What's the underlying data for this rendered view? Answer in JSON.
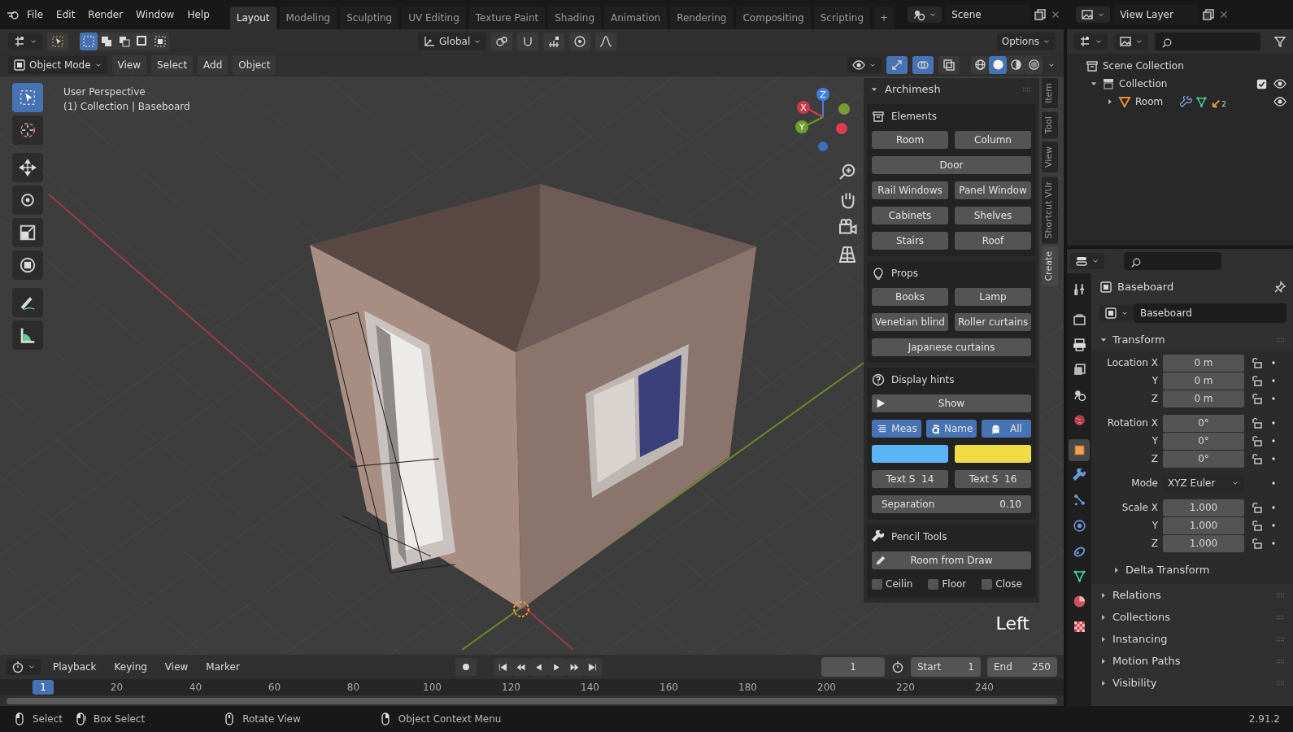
{
  "menu": [
    "File",
    "Edit",
    "Render",
    "Window",
    "Help"
  ],
  "workspaces": [
    {
      "label": "Layout",
      "selected": true
    },
    {
      "label": "Modeling",
      "selected": false
    },
    {
      "label": "Sculpting",
      "selected": false
    },
    {
      "label": "UV Editing",
      "selected": false
    },
    {
      "label": "Texture Paint",
      "selected": false
    },
    {
      "label": "Shading",
      "selected": false
    },
    {
      "label": "Animation",
      "selected": false
    },
    {
      "label": "Rendering",
      "selected": false
    },
    {
      "label": "Compositing",
      "selected": false
    },
    {
      "label": "Scripting",
      "selected": false
    }
  ],
  "add_tab": "+",
  "scene": "Scene",
  "view_layer": "View Layer",
  "tool_header": {
    "select_modes": [
      {
        "selected": true
      },
      {
        "selected": false
      },
      {
        "selected": false
      },
      {
        "selected": false
      },
      {
        "selected": false
      }
    ],
    "orientation": "Global",
    "options": "Options"
  },
  "viewport_header": {
    "mode": "Object Mode",
    "menus": [
      "View",
      "Select",
      "Add",
      "Object"
    ],
    "toggles": [
      {
        "kind": "gizmo",
        "on": true
      },
      {
        "kind": "overlay",
        "on": true
      },
      {
        "kind": "xray",
        "on": false
      }
    ],
    "shading": [
      {
        "kind": "wireframe",
        "selected": false
      },
      {
        "kind": "solid",
        "selected": true
      },
      {
        "kind": "material",
        "selected": false
      },
      {
        "kind": "rendered",
        "selected": false
      }
    ]
  },
  "tools": [
    {
      "kind": "select",
      "selected": true
    },
    {
      "kind": "cursor",
      "selected": false
    },
    {
      "kind": "move",
      "selected": false
    },
    {
      "kind": "rotate",
      "selected": false
    },
    {
      "kind": "scale",
      "selected": false
    },
    {
      "kind": "transform",
      "selected": false
    },
    {
      "kind": "annotate",
      "selected": false
    },
    {
      "kind": "measure",
      "selected": false
    }
  ],
  "viewport": {
    "perspective": "User Perspective",
    "context": "(1) Collection | Baseboard",
    "view_name": "Left",
    "gizmo_axes": [
      "X",
      "Y",
      "Z"
    ]
  },
  "sidebar": {
    "tabs": [
      {
        "label": "Item",
        "selected": false
      },
      {
        "label": "Tool",
        "selected": false
      },
      {
        "label": "View",
        "selected": false
      },
      {
        "label": "Shortcut VUr",
        "selected": false
      },
      {
        "label": "Create",
        "selected": true
      }
    ],
    "panel_title": "Archimesh",
    "sections": [
      {
        "title": "Elements",
        "rows": [
          {
            "items": [
              {
                "kind": "button",
                "label": "Room"
              },
              {
                "kind": "button",
                "label": "Column"
              }
            ]
          },
          {
            "items": [
              {
                "kind": "button",
                "label": "Door"
              }
            ]
          },
          {
            "items": [
              {
                "kind": "button",
                "label": "Rail Windows"
              },
              {
                "kind": "button",
                "label": "Panel Window"
              }
            ]
          },
          {
            "items": [
              {
                "kind": "button",
                "label": "Cabinets"
              },
              {
                "kind": "button",
                "label": "Shelves"
              }
            ]
          },
          {
            "items": [
              {
                "kind": "button",
                "label": "Stairs"
              },
              {
                "kind": "button",
                "label": "Roof"
              }
            ]
          }
        ]
      },
      {
        "title": "Props",
        "rows": [
          {
            "items": [
              {
                "kind": "button",
                "label": "Books"
              },
              {
                "kind": "button",
                "label": "Lamp"
              }
            ]
          },
          {
            "items": [
              {
                "kind": "button",
                "label": "Venetian blind"
              },
              {
                "kind": "button",
                "label": "Roller curtains"
              }
            ]
          },
          {
            "items": [
              {
                "kind": "button",
                "label": "Japanese curtains"
              }
            ]
          }
        ]
      },
      {
        "title": "Display hints",
        "rows": [
          {
            "items": [
              {
                "kind": "play",
                "label": "Show"
              }
            ]
          },
          {
            "items": [
              {
                "kind": "toggle",
                "label": "Meas",
                "on": true
              },
              {
                "kind": "toggle",
                "label": "Name",
                "on": true
              },
              {
                "kind": "toggle",
                "label": "All",
                "on": true
              }
            ]
          },
          {
            "items": [
              {
                "kind": "swatch",
                "color": "#5ab4f5"
              },
              {
                "kind": "swatch",
                "color": "#f0dc46"
              }
            ]
          },
          {
            "items": [
              {
                "kind": "number",
                "label": "Text S",
                "value": "14"
              },
              {
                "kind": "number",
                "label": "Text S",
                "value": "16"
              }
            ]
          },
          {
            "items": [
              {
                "kind": "field",
                "label": "Separation",
                "value": "0.10"
              }
            ]
          }
        ]
      },
      {
        "title": "Pencil Tools",
        "rows": [
          {
            "items": [
              {
                "kind": "pencil",
                "label": "Room from Draw"
              }
            ]
          },
          {
            "items": [
              {
                "kind": "checkbox",
                "label": "Ceilin",
                "checked": false
              },
              {
                "kind": "checkbox",
                "label": "Floor",
                "checked": false
              },
              {
                "kind": "checkbox",
                "label": "Close",
                "checked": false
              }
            ]
          }
        ]
      }
    ]
  },
  "outliner": {
    "tree": [
      {
        "label": "Scene Collection",
        "kind": "scene_collection",
        "children": [
          {
            "label": "Collection",
            "kind": "collection",
            "expanded": true,
            "checked": true,
            "visible": true,
            "children": [
              {
                "label": "Room",
                "kind": "object",
                "expanded": false,
                "visible": true,
                "modifier_count": "2"
              }
            ]
          }
        ]
      }
    ]
  },
  "properties": {
    "tabs": [
      {
        "kind": "tool",
        "selected": false
      },
      {
        "kind": "render",
        "selected": false
      },
      {
        "kind": "output",
        "selected": false
      },
      {
        "kind": "view_layer",
        "selected": false
      },
      {
        "kind": "scene",
        "selected": false
      },
      {
        "kind": "world",
        "selected": false
      },
      {
        "kind": "object",
        "selected": true
      },
      {
        "kind": "modifiers",
        "selected": false
      },
      {
        "kind": "particles",
        "selected": false
      },
      {
        "kind": "physics",
        "selected": false
      },
      {
        "kind": "constraints",
        "selected": false
      },
      {
        "kind": "data",
        "selected": false
      },
      {
        "kind": "material",
        "selected": false
      },
      {
        "kind": "texture",
        "selected": false
      }
    ],
    "title": "Baseboard",
    "name_field": "Baseboard",
    "transform": {
      "title": "Transform",
      "expanded": true,
      "groups": [
        [
          {
            "kind": "number",
            "label": "Location X",
            "value": "0 m",
            "locked": false
          },
          {
            "kind": "number",
            "label": "Y",
            "value": "0 m",
            "locked": false
          },
          {
            "kind": "number",
            "label": "Z",
            "value": "0 m",
            "locked": false
          }
        ],
        [
          {
            "kind": "number",
            "label": "Rotation X",
            "value": "0°",
            "locked": false
          },
          {
            "kind": "number",
            "label": "Y",
            "value": "0°",
            "locked": false
          },
          {
            "kind": "number",
            "label": "Z",
            "value": "0°",
            "locked": false
          }
        ],
        [
          {
            "kind": "dropdown",
            "label": "Mode",
            "value": "XYZ Euler"
          }
        ],
        [
          {
            "kind": "number",
            "label": "Scale X",
            "value": "1.000",
            "locked": false
          },
          {
            "kind": "number",
            "label": "Y",
            "value": "1.000",
            "locked": false
          },
          {
            "kind": "number",
            "label": "Z",
            "value": "1.000",
            "locked": false
          }
        ]
      ]
    },
    "delta": {
      "title": "Delta Transform",
      "expanded": false
    },
    "sections": [
      {
        "title": "Relations",
        "expanded": false
      },
      {
        "title": "Collections",
        "expanded": false
      },
      {
        "title": "Instancing",
        "expanded": false
      },
      {
        "title": "Motion Paths",
        "expanded": false
      },
      {
        "title": "Visibility",
        "expanded": false
      }
    ]
  },
  "timeline": {
    "menus": [
      "Playback",
      "Keying",
      "View",
      "Marker"
    ],
    "current_frame": "1",
    "start_label": "Start",
    "start": "1",
    "end_label": "End",
    "end": "250",
    "ruler": [
      {
        "label": "1",
        "selected": true
      },
      {
        "label": "20",
        "selected": false
      },
      {
        "label": "40",
        "selected": false
      },
      {
        "label": "60",
        "selected": false
      },
      {
        "label": "80",
        "selected": false
      },
      {
        "label": "100",
        "selected": false
      },
      {
        "label": "120",
        "selected": false
      },
      {
        "label": "140",
        "selected": false
      },
      {
        "label": "160",
        "selected": false
      },
      {
        "label": "180",
        "selected": false
      },
      {
        "label": "200",
        "selected": false
      },
      {
        "label": "220",
        "selected": false
      },
      {
        "label": "240",
        "selected": false
      }
    ]
  },
  "status_bar": {
    "hints": [
      {
        "kind": "left",
        "label": "Select"
      },
      {
        "kind": "drag",
        "label": "Box Select"
      },
      {
        "kind": "middle",
        "label": "Rotate View"
      },
      {
        "kind": "right",
        "label": "Object Context Menu"
      }
    ],
    "version": "2.91.2"
  }
}
